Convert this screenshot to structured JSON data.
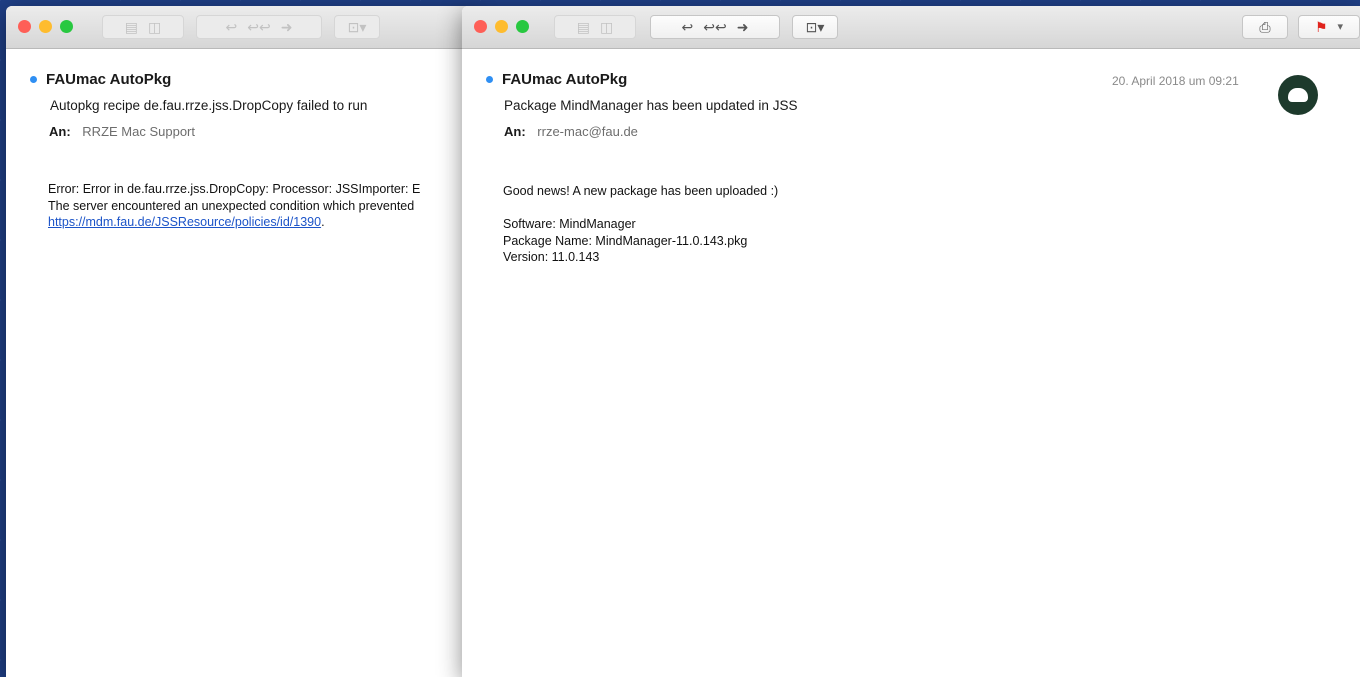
{
  "left_window": {
    "sender": "FAUmac AutoPkg",
    "subject": "Autopkg recipe de.fau.rrze.jss.DropCopy failed to run",
    "to_label": "An:",
    "to_value": "RRZE Mac Support",
    "body_lines": [
      "Error: Error in de.fau.rrze.jss.DropCopy: Processor: JSSImporter: E",
      "The server encountered an unexpected condition which prevented"
    ],
    "body_link": "https://mdm.fau.de/JSSResource/policies/id/1390",
    "body_link_suffix": "."
  },
  "right_window": {
    "sender": "FAUmac AutoPkg",
    "date": "20. April 2018 um 09:21",
    "subject": "Package MindManager has been updated in JSS",
    "to_label": "An:",
    "to_value": "rrze-mac@fau.de",
    "body_greeting": "Good news! A new package has been uploaded :)",
    "body_lines": [
      "Software: MindManager",
      "Package Name: MindManager-11.0.143.pkg",
      "Version: 11.0.143"
    ]
  },
  "colors": {
    "close": "#fe5f57",
    "minimize": "#febc2e",
    "zoom": "#28c840",
    "unread": "#2f8ff3",
    "link": "#1c54c8",
    "flag": "#e0231c"
  },
  "icons": {
    "toolbar": [
      "archive-icon",
      "trash-icon",
      "reply-icon",
      "reply-all-icon",
      "forward-icon",
      "move-icon",
      "print-icon",
      "flag-icon"
    ]
  }
}
